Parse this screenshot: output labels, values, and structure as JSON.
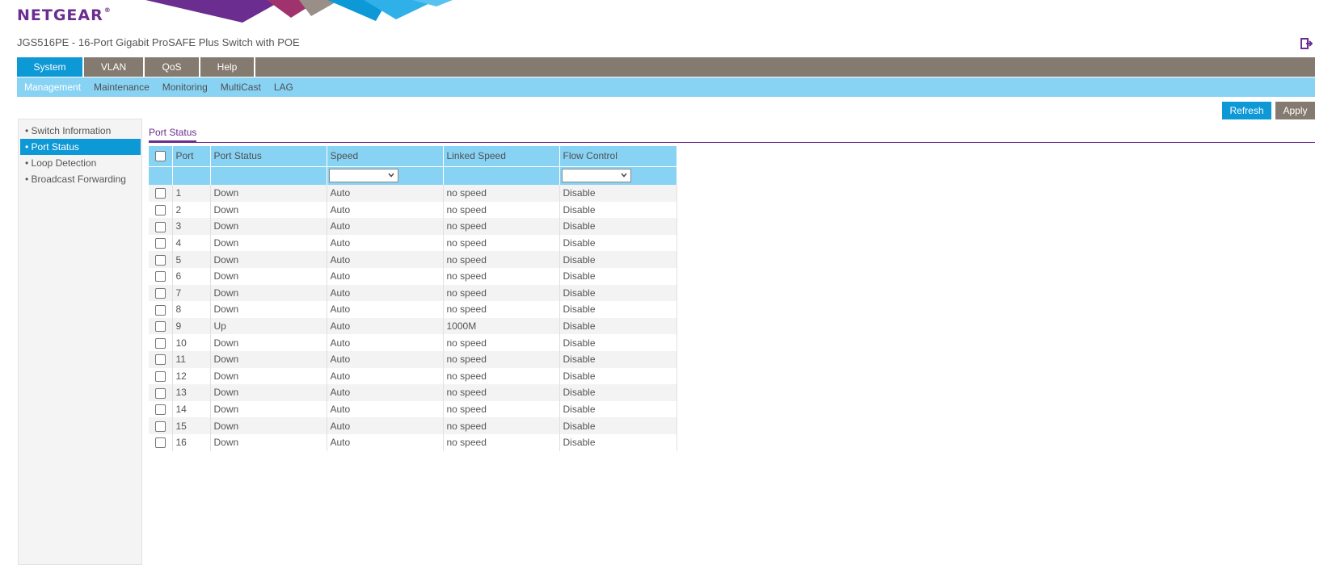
{
  "brand": {
    "logo_text": "NETGEAR",
    "logo_mark": "®"
  },
  "header": {
    "product_title": "JGS516PE - 16-Port Gigabit ProSAFE Plus Switch with POE",
    "logout_icon": "logout-icon"
  },
  "colors": {
    "brand_purple": "#6b2d8f",
    "active_blue": "#0d98d6",
    "nav_gray": "#857a70",
    "light_blue": "#88d3f4"
  },
  "main_nav": [
    {
      "label": "System",
      "active": true
    },
    {
      "label": "VLAN",
      "active": false
    },
    {
      "label": "QoS",
      "active": false
    },
    {
      "label": "Help",
      "active": false
    }
  ],
  "sub_nav": [
    {
      "label": "Management",
      "active": true
    },
    {
      "label": "Maintenance",
      "active": false
    },
    {
      "label": "Monitoring",
      "active": false
    },
    {
      "label": "MultiCast",
      "active": false
    },
    {
      "label": "LAG",
      "active": false
    }
  ],
  "buttons": {
    "refresh": "Refresh",
    "apply": "Apply"
  },
  "sidebar": [
    {
      "label": "• Switch Information",
      "active": false
    },
    {
      "label": "• Port Status",
      "active": true
    },
    {
      "label": "• Loop Detection",
      "active": false
    },
    {
      "label": "• Broadcast Forwarding",
      "active": false
    }
  ],
  "section_title": "Port Status",
  "table": {
    "columns": [
      "Port",
      "Port Status",
      "Speed",
      "Linked Speed",
      "Flow Control"
    ],
    "filters": {
      "speed": "",
      "flow_control": ""
    },
    "rows": [
      {
        "port": "1",
        "status": "Down",
        "speed": "Auto",
        "linked_speed": "no speed",
        "flow_control": "Disable"
      },
      {
        "port": "2",
        "status": "Down",
        "speed": "Auto",
        "linked_speed": "no speed",
        "flow_control": "Disable"
      },
      {
        "port": "3",
        "status": "Down",
        "speed": "Auto",
        "linked_speed": "no speed",
        "flow_control": "Disable"
      },
      {
        "port": "4",
        "status": "Down",
        "speed": "Auto",
        "linked_speed": "no speed",
        "flow_control": "Disable"
      },
      {
        "port": "5",
        "status": "Down",
        "speed": "Auto",
        "linked_speed": "no speed",
        "flow_control": "Disable"
      },
      {
        "port": "6",
        "status": "Down",
        "speed": "Auto",
        "linked_speed": "no speed",
        "flow_control": "Disable"
      },
      {
        "port": "7",
        "status": "Down",
        "speed": "Auto",
        "linked_speed": "no speed",
        "flow_control": "Disable"
      },
      {
        "port": "8",
        "status": "Down",
        "speed": "Auto",
        "linked_speed": "no speed",
        "flow_control": "Disable"
      },
      {
        "port": "9",
        "status": "Up",
        "speed": "Auto",
        "linked_speed": "1000M",
        "flow_control": "Disable"
      },
      {
        "port": "10",
        "status": "Down",
        "speed": "Auto",
        "linked_speed": "no speed",
        "flow_control": "Disable"
      },
      {
        "port": "11",
        "status": "Down",
        "speed": "Auto",
        "linked_speed": "no speed",
        "flow_control": "Disable"
      },
      {
        "port": "12",
        "status": "Down",
        "speed": "Auto",
        "linked_speed": "no speed",
        "flow_control": "Disable"
      },
      {
        "port": "13",
        "status": "Down",
        "speed": "Auto",
        "linked_speed": "no speed",
        "flow_control": "Disable"
      },
      {
        "port": "14",
        "status": "Down",
        "speed": "Auto",
        "linked_speed": "no speed",
        "flow_control": "Disable"
      },
      {
        "port": "15",
        "status": "Down",
        "speed": "Auto",
        "linked_speed": "no speed",
        "flow_control": "Disable"
      },
      {
        "port": "16",
        "status": "Down",
        "speed": "Auto",
        "linked_speed": "no speed",
        "flow_control": "Disable"
      }
    ]
  }
}
